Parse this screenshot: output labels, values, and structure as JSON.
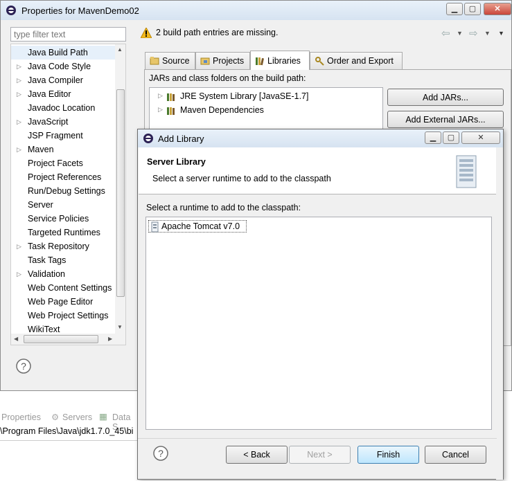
{
  "props_window": {
    "title": "Properties for MavenDemo02",
    "filter_placeholder": "type filter text",
    "warning": "2 build path entries are missing.",
    "tree_items": [
      {
        "label": "Java Build Path",
        "arrow": "",
        "selected": true
      },
      {
        "label": "Java Code Style",
        "arrow": "▷"
      },
      {
        "label": "Java Compiler",
        "arrow": "▷"
      },
      {
        "label": "Java Editor",
        "arrow": "▷"
      },
      {
        "label": "Javadoc Location",
        "arrow": ""
      },
      {
        "label": "JavaScript",
        "arrow": "▷"
      },
      {
        "label": "JSP Fragment",
        "arrow": ""
      },
      {
        "label": "Maven",
        "arrow": "▷"
      },
      {
        "label": "Project Facets",
        "arrow": ""
      },
      {
        "label": "Project References",
        "arrow": ""
      },
      {
        "label": "Run/Debug Settings",
        "arrow": ""
      },
      {
        "label": "Server",
        "arrow": ""
      },
      {
        "label": "Service Policies",
        "arrow": ""
      },
      {
        "label": "Targeted Runtimes",
        "arrow": ""
      },
      {
        "label": "Task Repository",
        "arrow": "▷"
      },
      {
        "label": "Task Tags",
        "arrow": ""
      },
      {
        "label": "Validation",
        "arrow": "▷"
      },
      {
        "label": "Web Content Settings",
        "arrow": ""
      },
      {
        "label": "Web Page Editor",
        "arrow": ""
      },
      {
        "label": "Web Project Settings",
        "arrow": ""
      },
      {
        "label": "WikiText",
        "arrow": ""
      }
    ],
    "tabs": [
      "Source",
      "Projects",
      "Libraries",
      "Order and Export"
    ],
    "build_path_label": "JARs and class folders on the build path:",
    "libraries": [
      "JRE System Library [JavaSE-1.7]",
      "Maven Dependencies"
    ],
    "add_jars": "Add JARs...",
    "add_external_jars": "Add External JARs..."
  },
  "background_view": {
    "tabs": [
      "Properties",
      "Servers",
      "Data S"
    ],
    "path_text": "\\Program Files\\Java\\jdk1.7.0_45\\bi"
  },
  "dialog": {
    "title": "Add Library",
    "heading": "Server Library",
    "description": "Select a server runtime to add to the classpath",
    "list_label": "Select a runtime to add to the classpath:",
    "runtimes": [
      "Apache Tomcat v7.0"
    ],
    "back": "< Back",
    "next": "Next >",
    "finish": "Finish",
    "cancel": "Cancel"
  },
  "icons": {
    "help": "question-icon",
    "warning": "warning-icon"
  },
  "colors": {
    "title_bar": "#dde9f5",
    "warning": "#e8a317",
    "selection": "#cce8ff"
  }
}
